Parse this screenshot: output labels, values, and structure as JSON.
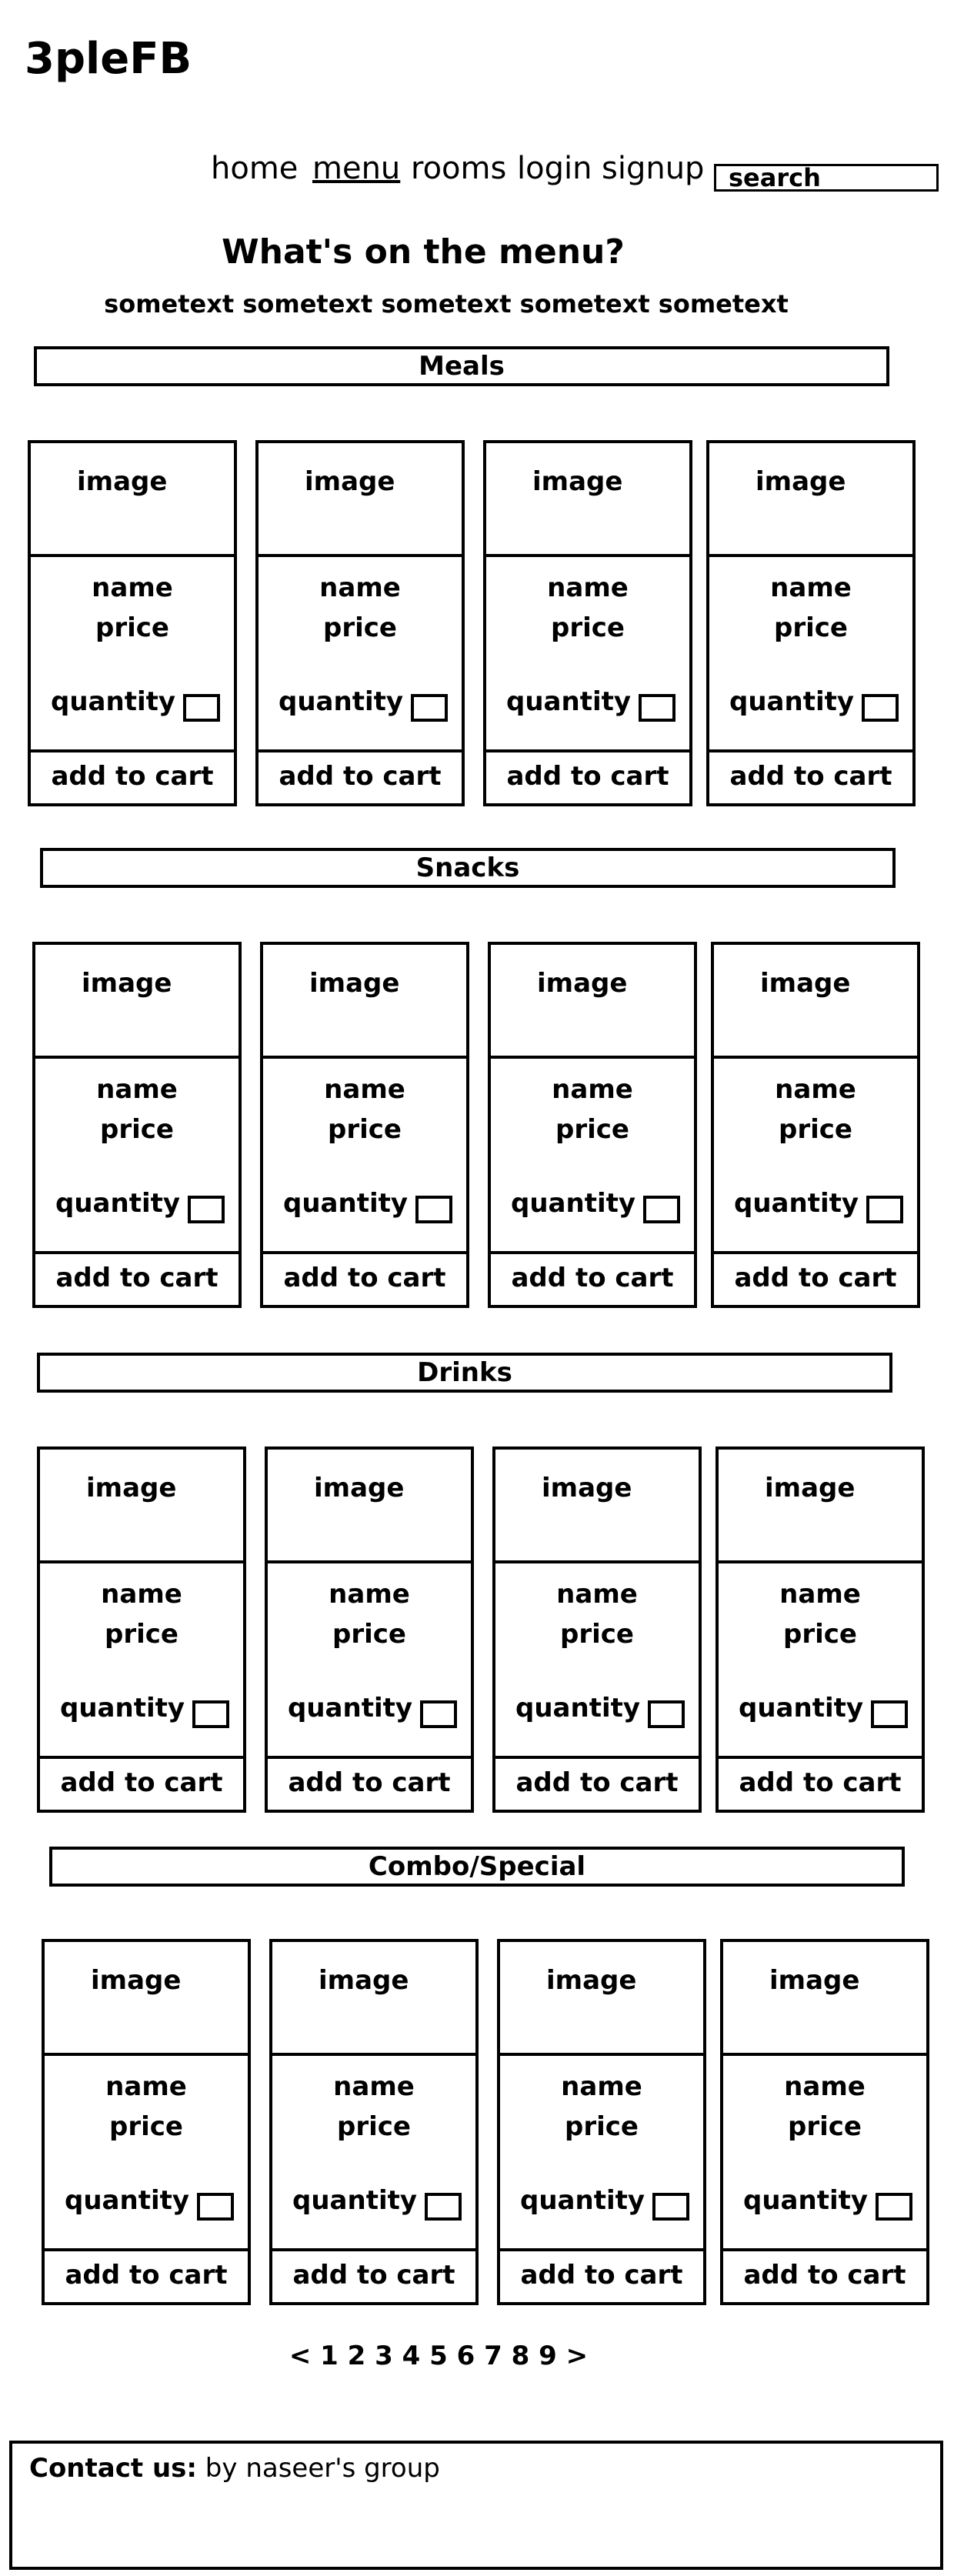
{
  "header": {
    "logo": "3pleFB"
  },
  "nav": {
    "items": [
      "home",
      "menu",
      "rooms",
      "login",
      "signup"
    ],
    "search_label": "search"
  },
  "hero": {
    "title": "What's on the menu?",
    "subtitle": "sometext sometext sometext  sometext sometext"
  },
  "sections": [
    {
      "title": "Meals"
    },
    {
      "title": "Snacks"
    },
    {
      "title": "Drinks"
    },
    {
      "title": "Combo/Special"
    }
  ],
  "card": {
    "image_label": "image",
    "name_label": "name",
    "price_label": "price",
    "quantity_label": "quantity",
    "button_label": "add to cart"
  },
  "pagination": {
    "text": "< 1 2 3 4 5 6 7 8 9 >"
  },
  "footer": {
    "label": "Contact us:",
    "text": " by naseer's group"
  }
}
